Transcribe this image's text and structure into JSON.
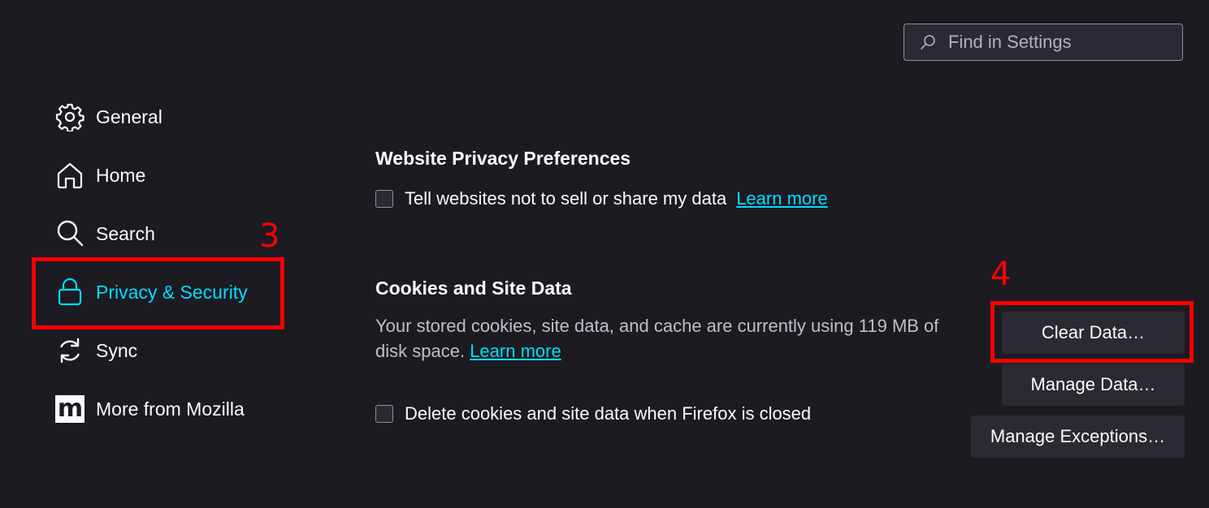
{
  "search": {
    "placeholder": "Find in Settings",
    "icon": "search-icon"
  },
  "sidebar": {
    "items": [
      {
        "label": "General",
        "icon": "gear-icon",
        "selected": false
      },
      {
        "label": "Home",
        "icon": "home-icon",
        "selected": false
      },
      {
        "label": "Search",
        "icon": "search-icon",
        "selected": false
      },
      {
        "label": "Privacy & Security",
        "icon": "lock-icon",
        "selected": true
      },
      {
        "label": "Sync",
        "icon": "sync-icon",
        "selected": false
      },
      {
        "label": "More from Mozilla",
        "icon": "mozilla-logo-icon",
        "selected": false
      }
    ]
  },
  "privacy_prefs": {
    "heading": "Website Privacy Preferences",
    "checkbox_label": "Tell websites not to sell or share my data",
    "checked": false,
    "learn_more": "Learn more"
  },
  "cookies": {
    "heading": "Cookies and Site Data",
    "description": "Your stored cookies, site data, and cache are currently using 119 MB of disk space.",
    "learn_more": "Learn more",
    "clear_button": "Clear Data…",
    "manage_button": "Manage Data…",
    "exceptions_button": "Manage Exceptions…",
    "delete_checkbox_label": "Delete cookies and site data when Firefox is closed",
    "delete_checked": false
  },
  "annotations": {
    "step3": "3",
    "step4": "4",
    "color": "#ff0000"
  },
  "colors": {
    "background": "#1c1b22",
    "accent": "#00ddff",
    "button": "#2b2a33",
    "text": "#fbfbfe"
  }
}
